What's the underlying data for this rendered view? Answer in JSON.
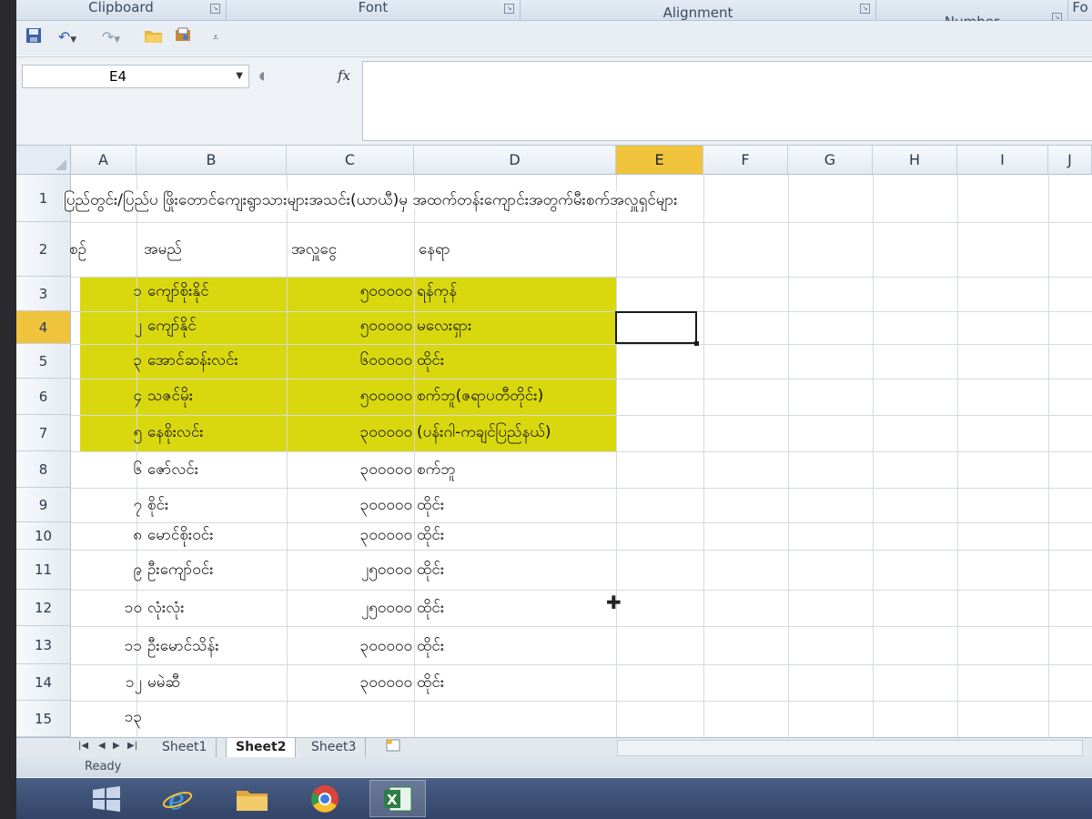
{
  "ribbon": {
    "groups": [
      "Clipboard",
      "Font",
      "Alignment",
      "Number",
      "Fo"
    ]
  },
  "quick_access": {
    "icons": [
      "save-icon",
      "undo-icon",
      "redo-icon",
      "open-folder-icon",
      "print-preview-icon",
      "customize-icon"
    ]
  },
  "formula_bar": {
    "name_box": "E4",
    "fx_label": "fx",
    "formula": ""
  },
  "grid": {
    "columns": [
      "A",
      "B",
      "C",
      "D",
      "E",
      "F",
      "G",
      "H",
      "I",
      "J"
    ],
    "selected_column": "E",
    "rows": [
      "1",
      "2",
      "3",
      "4",
      "5",
      "6",
      "7",
      "8",
      "9",
      "10",
      "11",
      "12",
      "13",
      "14",
      "15"
    ],
    "selected_row": "4",
    "active_cell": "E4",
    "highlight_color": "#d9d80e",
    "title": "ပြည်တွင်း/ပြည်ပ ဖြိုးတောင်ကျေးရွာသားများအသင်း(ယာယီ)မှ အထက်တန်းကျောင်းအတွက်မီးစက်အလှူရှင်များ",
    "headers": [
      "စဉ်",
      "အမည်",
      "အလှူငွေ",
      "နေရာ"
    ],
    "data_rows": [
      {
        "no": "၁",
        "name": "ကျော်စိုးနိုင်",
        "amount": "၅၀၀၀၀၀",
        "place": "ရန်ကုန်"
      },
      {
        "no": "၂",
        "name": "ကျော်နိုင်",
        "amount": "၅၀၀၀၀၀",
        "place": "မလေးရှား"
      },
      {
        "no": "၃",
        "name": "အောင်ဆန်းလင်း",
        "amount": "၆၀၀၀၀၀",
        "place": "ထိုင်း"
      },
      {
        "no": "၄",
        "name": "သဇင်မိုး",
        "amount": "၅၀၀၀၀၀",
        "place": "စက်ဘူ(ဇရာပတီတိုင်း)"
      },
      {
        "no": "၅",
        "name": "နေစိုးလင်း",
        "amount": "၃၀၀၀၀၀",
        "place": "(ပန်းဂါ-ကချင်ပြည်နယ်)"
      },
      {
        "no": "၆",
        "name": "ဇော်လင်း",
        "amount": "၃၀၀၀၀၀",
        "place": "စက်ဘူ"
      },
      {
        "no": "၇",
        "name": "စိုင်း",
        "amount": "၃၀၀၀၀၀",
        "place": "ထိုင်း"
      },
      {
        "no": "၈",
        "name": "မောင်စိုးဝင်း",
        "amount": "၃၀၀၀၀၀",
        "place": "ထိုင်း"
      },
      {
        "no": "၉",
        "name": "ဦးကျော်ဝင်း",
        "amount": "၂၅၀၀၀၀",
        "place": "ထိုင်း"
      },
      {
        "no": "၁၀",
        "name": "လုံးလုံး",
        "amount": "၂၅၀၀၀၀",
        "place": "ထိုင်း"
      },
      {
        "no": "၁၁",
        "name": "ဦးမောင်သိန်း",
        "amount": "၃၀၀၀၀၀",
        "place": "ထိုင်း"
      },
      {
        "no": "၁၂",
        "name": "မမဲဆီ",
        "amount": "၃၀၀၀၀၀",
        "place": "ထိုင်း"
      },
      {
        "no": "၁၃",
        "name": "",
        "amount": "",
        "place": ""
      }
    ]
  },
  "sheets": {
    "tabs": [
      "Sheet1",
      "Sheet2",
      "Sheet3"
    ],
    "active": "Sheet2"
  },
  "status": {
    "text": "Ready"
  },
  "taskbar": {
    "items": [
      "windows-start-icon",
      "internet-explorer-icon",
      "file-explorer-icon",
      "chrome-icon",
      "excel-icon"
    ],
    "active": "excel-icon"
  }
}
